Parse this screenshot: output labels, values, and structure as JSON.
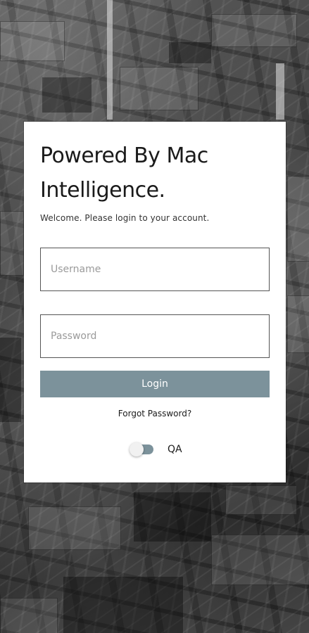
{
  "login": {
    "title": "Powered By Mac Intelligence.",
    "subtitle": "Welcome. Please login to your account.",
    "username_placeholder": "Username",
    "password_placeholder": "Password",
    "login_label": "Login",
    "forgot_label": "Forgot Password?"
  },
  "environment_toggle": {
    "label": "QA",
    "enabled": false
  },
  "colors": {
    "button": "#7c929b",
    "card": "#ffffff"
  }
}
